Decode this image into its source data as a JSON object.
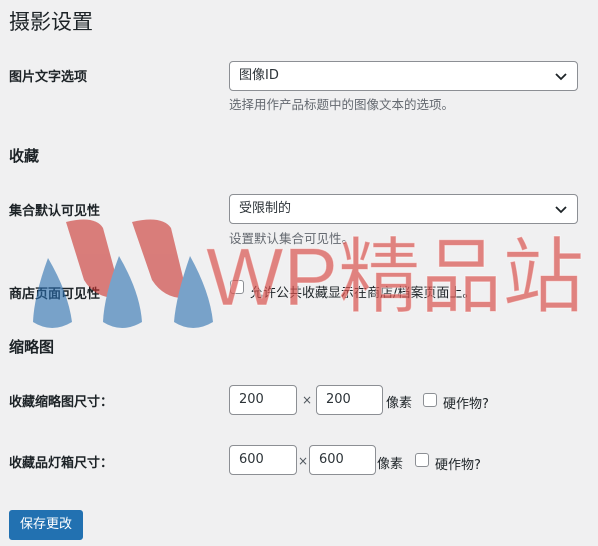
{
  "page": {
    "title": "摄影设置"
  },
  "image_text": {
    "label": "图片文字选项",
    "selected": "图像ID",
    "description": "选择用作产品标题中的图像文本的选项。"
  },
  "collections": {
    "heading": "收藏",
    "visibility_label": "集合默认可见性",
    "visibility_selected": "受限制的",
    "visibility_description": "设置默认集合可见性。",
    "shop_visibility_label": "商店页面可见性",
    "shop_visibility_checkbox": "允许公共收藏显示在商店/档案页面上。"
  },
  "thumbnails": {
    "heading": "缩略图",
    "thumb_label": "收藏缩略图尺寸：",
    "thumb_width": "200",
    "thumb_height": "200",
    "lightbox_label": "收藏品灯箱尺寸：",
    "lightbox_width": "600",
    "lightbox_height": "600",
    "times": "×",
    "unit": "像素",
    "hard_crop": "硬作物?"
  },
  "actions": {
    "save": "保存更改"
  },
  "watermark": {
    "text": "WP精品站"
  },
  "colors": {
    "primary": "#2271b1",
    "watermark_red": "#d9534f",
    "watermark_blue": "#3a7fc1"
  }
}
